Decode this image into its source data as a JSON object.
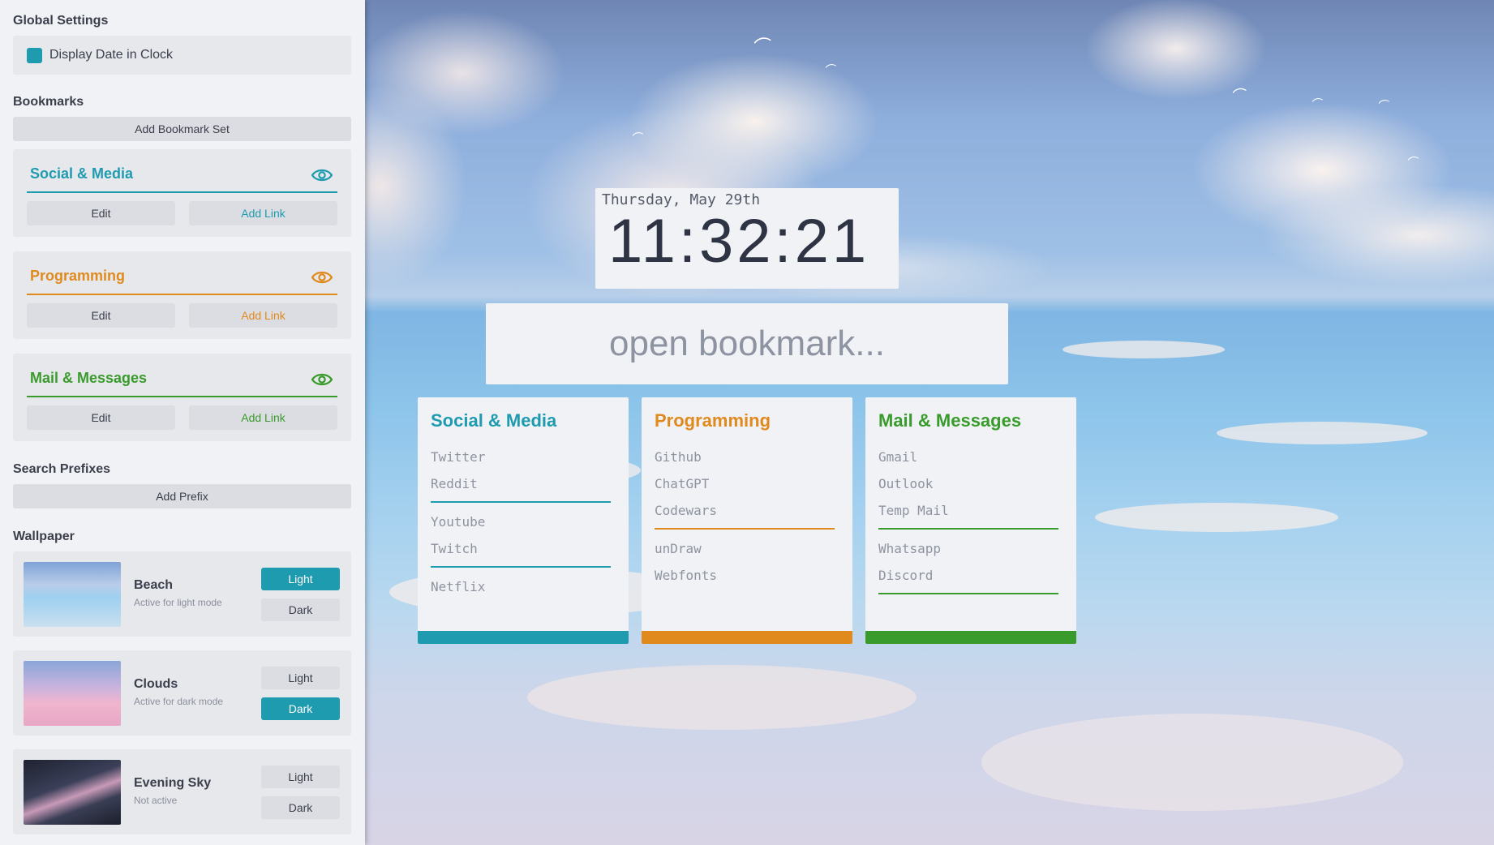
{
  "colors": {
    "teal": "#1f9bb0",
    "orange": "#e08a1e",
    "green": "#3a9b2d"
  },
  "sidebar": {
    "global_title": "Global Settings",
    "display_date_label": "Display Date in Clock",
    "bookmarks_title": "Bookmarks",
    "add_bookmark_set": "Add Bookmark Set",
    "sets": [
      {
        "title": "Social & Media",
        "edit": "Edit",
        "add_link": "Add Link",
        "icon": "eye-icon"
      },
      {
        "title": "Programming",
        "edit": "Edit",
        "add_link": "Add Link",
        "icon": "eye-icon"
      },
      {
        "title": "Mail & Messages",
        "edit": "Edit",
        "add_link": "Add Link",
        "icon": "eye-icon"
      }
    ],
    "prefixes_title": "Search Prefixes",
    "add_prefix": "Add Prefix",
    "wallpaper_title": "Wallpaper",
    "wallpapers": [
      {
        "name": "Beach",
        "status": "Active for light mode",
        "light": "Light",
        "dark": "Dark",
        "selected": "light"
      },
      {
        "name": "Clouds",
        "status": "Active for dark mode",
        "light": "Light",
        "dark": "Dark",
        "selected": "dark"
      },
      {
        "name": "Evening Sky",
        "status": "Not active",
        "light": "Light",
        "dark": "Dark",
        "selected": "none"
      }
    ]
  },
  "clock": {
    "date": "Thursday, May 29th",
    "time": "11:32:21"
  },
  "search": {
    "placeholder": "open bookmark..."
  },
  "cards": [
    {
      "title": "Social & Media",
      "groups": [
        [
          "Twitter",
          "Reddit"
        ],
        [
          "Youtube",
          "Twitch"
        ],
        [
          "Netflix"
        ]
      ]
    },
    {
      "title": "Programming",
      "groups": [
        [
          "Github",
          "ChatGPT",
          "Codewars"
        ],
        [
          "unDraw",
          "Webfonts"
        ]
      ]
    },
    {
      "title": "Mail & Messages",
      "groups": [
        [
          "Gmail",
          "Outlook",
          "Temp Mail"
        ],
        [
          "Whatsapp",
          "Discord"
        ]
      ]
    }
  ]
}
